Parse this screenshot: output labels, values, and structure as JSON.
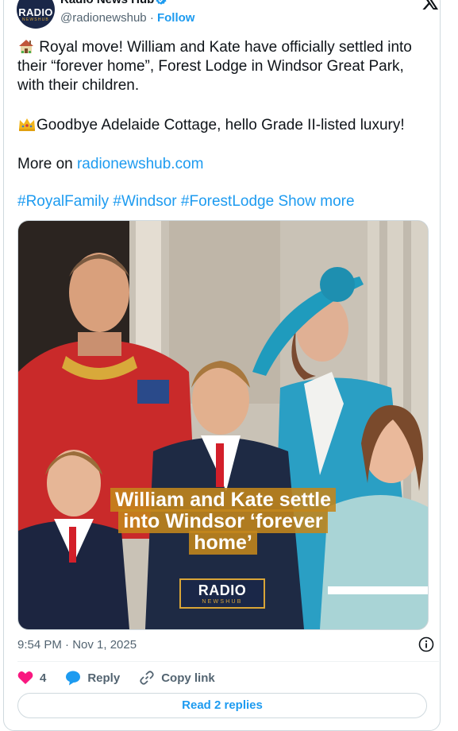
{
  "author": {
    "display_name": "Radio News Hub",
    "handle": "@radionewshub",
    "separator": "·",
    "follow_label": "Follow",
    "avatar_line1": "RADIO",
    "avatar_line2": "NEWSHUB"
  },
  "post": {
    "line1": "Royal move! William and Kate have officially settled into their “forever home”, Forest Lodge in Windsor Great Park, with their children.",
    "line2": "Goodbye Adelaide Cottage, hello Grade II-listed luxury!",
    "more_prefix": "More on ",
    "more_link": "radionewshub.com",
    "hashtags": [
      "#RoyalFamily",
      "#Windsor",
      "#ForestLodge"
    ],
    "show_more": "Show more",
    "emoji1": "house-icon",
    "emoji2": "crown-icon"
  },
  "media": {
    "caption": "William and Kate settle into Windsor ‘forever home’",
    "logo_line1": "RADIO",
    "logo_line2": "NEWSHUB"
  },
  "footer": {
    "timestamp": "9:54 PM · Nov 1, 2025",
    "likes": "4",
    "reply_label": "Reply",
    "copy_link_label": "Copy link",
    "read_replies_label": "Read 2 replies"
  },
  "colors": {
    "accent": "#1d9bf0",
    "like": "#f91880",
    "brand_navy": "#1a2748",
    "brand_gold": "#d9a537"
  }
}
